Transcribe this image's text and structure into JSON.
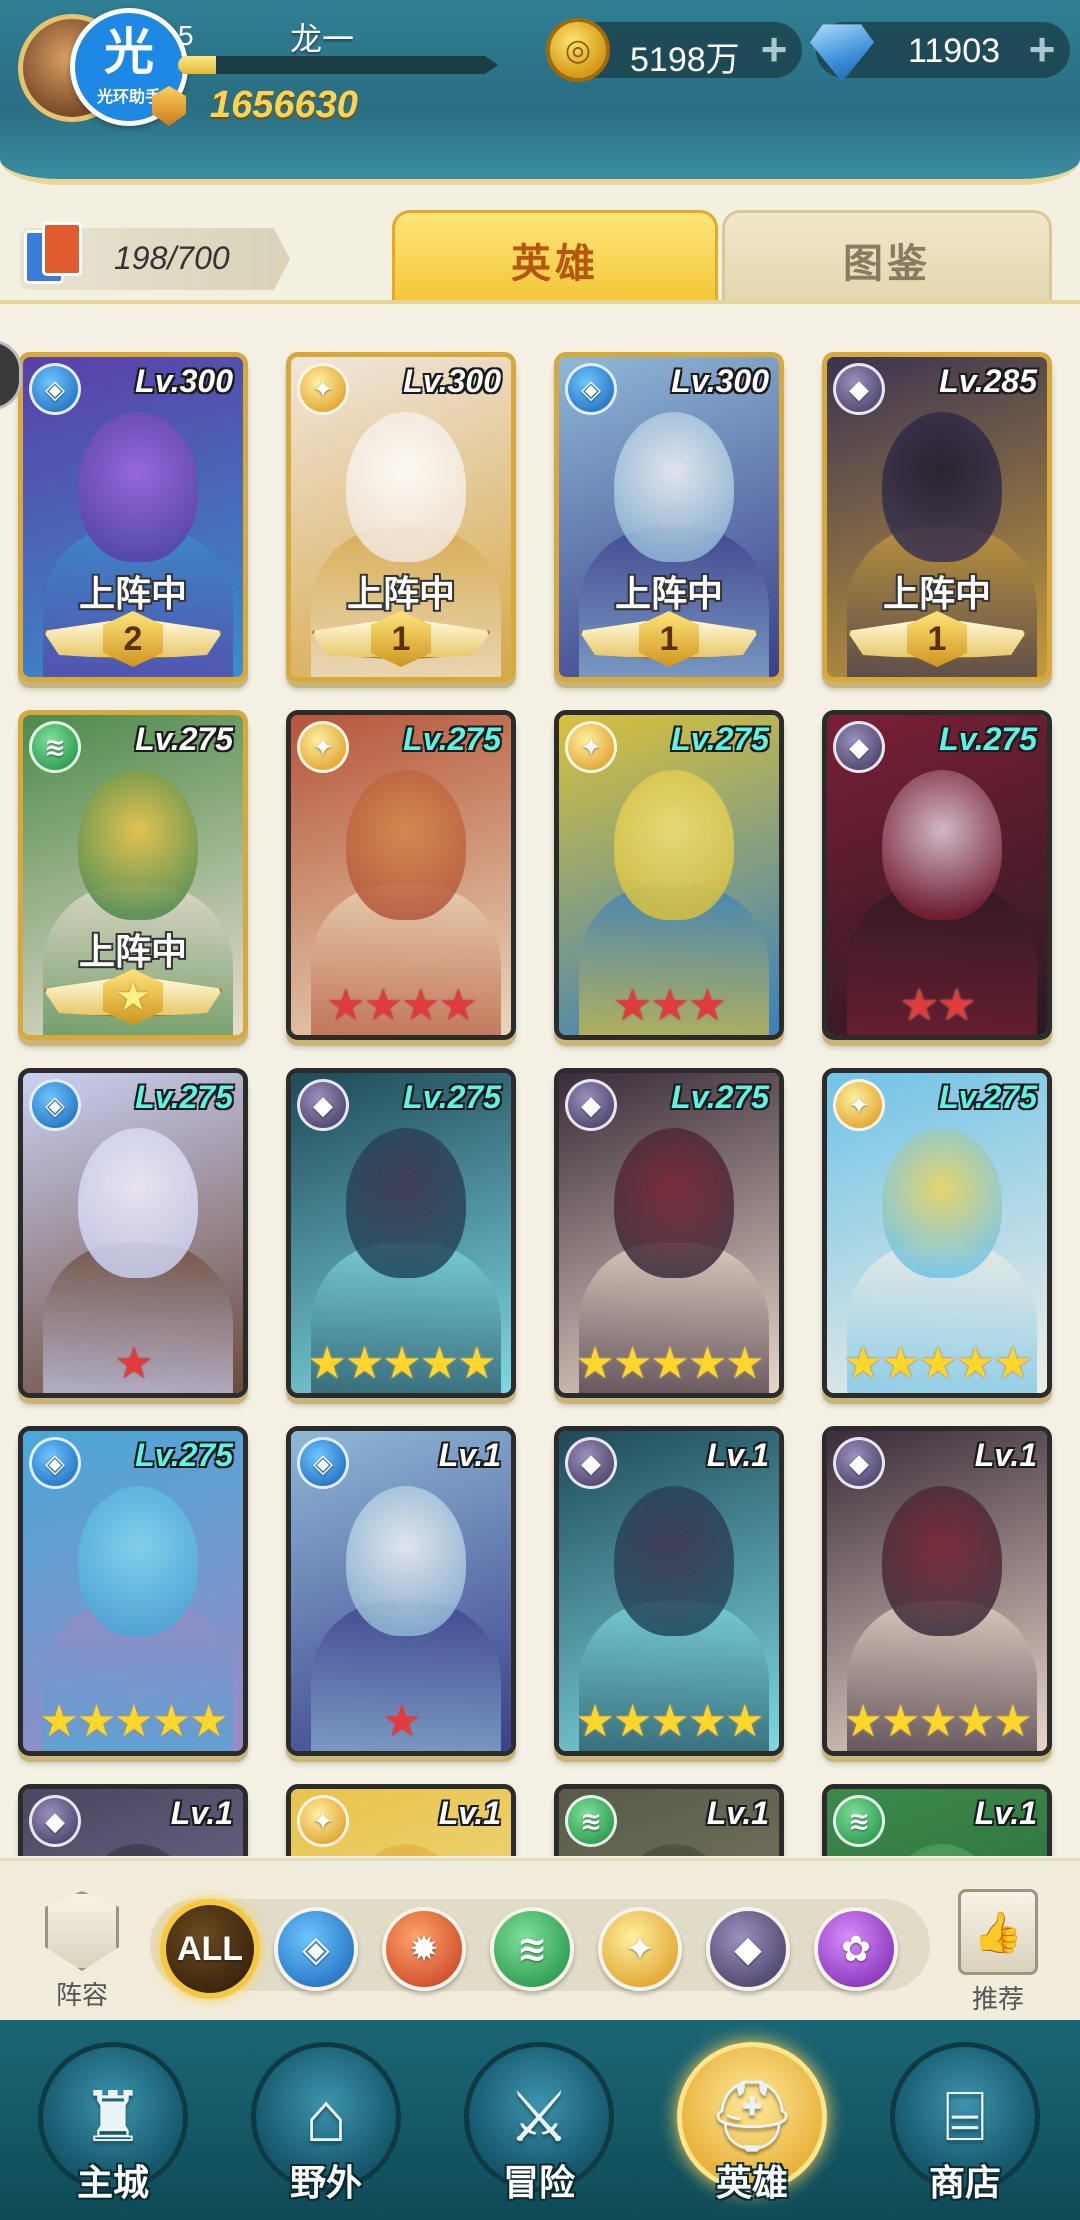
{
  "header": {
    "helper_badge_glyph": "光",
    "helper_badge_text": "光环助手",
    "level": "5",
    "player_name": "龙一",
    "exp_fraction": 0.12,
    "power": "1656630",
    "gold": "5198万",
    "diamonds": "11903",
    "plus": "+"
  },
  "tabs": {
    "hero_count": "198/700",
    "heroes": "英雄",
    "codex": "图鉴"
  },
  "heroes": [
    {
      "level": "Lv.300",
      "faction": "water",
      "deployed": "上阵中",
      "badge": "2",
      "stars": 0,
      "star_color": "",
      "lvl_color": "white",
      "art": [
        "#5a3fa8",
        "#a36ae0",
        "#3a8ec9"
      ]
    },
    {
      "level": "Lv.300",
      "faction": "light",
      "deployed": "上阵中",
      "badge": "1",
      "stars": 0,
      "star_color": "",
      "lvl_color": "white",
      "art": [
        "#f0e6dc",
        "#ffffff",
        "#d6a848"
      ]
    },
    {
      "level": "Lv.300",
      "faction": "water",
      "deployed": "上阵中",
      "badge": "1",
      "stars": 0,
      "star_color": "",
      "lvl_color": "white",
      "art": [
        "#8fb8d6",
        "#f4f4f4",
        "#3b3f8a"
      ]
    },
    {
      "level": "Lv.285",
      "faction": "dark",
      "deployed": "上阵中",
      "badge": "1",
      "stars": 0,
      "star_color": "",
      "lvl_color": "white",
      "art": [
        "#3a3352",
        "#1f1a2b",
        "#c59a3a"
      ]
    },
    {
      "level": "Lv.275",
      "faction": "wind",
      "deployed": "上阵中",
      "badge": "★",
      "stars": 0,
      "star_color": "",
      "lvl_color": "white",
      "art": [
        "#4d8a4a",
        "#f2c64a",
        "#e8ddd0"
      ]
    },
    {
      "level": "Lv.275",
      "faction": "light",
      "deployed": "",
      "badge": "",
      "stars": 4,
      "star_color": "red",
      "lvl_color": "cyan",
      "art": [
        "#b5553a",
        "#d48a4a",
        "#e9d7b8"
      ]
    },
    {
      "level": "Lv.275",
      "faction": "light",
      "deployed": "",
      "badge": "",
      "stars": 3,
      "star_color": "red",
      "lvl_color": "cyan",
      "art": [
        "#d8c13c",
        "#f2e27a",
        "#3a7fbf"
      ]
    },
    {
      "level": "Lv.275",
      "faction": "dark",
      "deployed": "",
      "badge": "",
      "stars": 2,
      "star_color": "red",
      "lvl_color": "cyan",
      "art": [
        "#7a1f35",
        "#e4d3e0",
        "#2b1a22"
      ]
    },
    {
      "level": "Lv.275",
      "faction": "water",
      "deployed": "",
      "badge": "",
      "stars": 1,
      "star_color": "red",
      "lvl_color": "cyan",
      "art": [
        "#c9d0f2",
        "#f4eef8",
        "#6d4a3a"
      ]
    },
    {
      "level": "Lv.275",
      "faction": "dark",
      "deployed": "",
      "badge": "",
      "stars": 5,
      "star_color": "yellow",
      "lvl_color": "cyan",
      "art": [
        "#1f4a5a",
        "#40334f",
        "#7fd8e0"
      ]
    },
    {
      "level": "Lv.275",
      "faction": "dark",
      "deployed": "",
      "badge": "",
      "stars": 5,
      "star_color": "yellow",
      "lvl_color": "cyan",
      "art": [
        "#3a2c3a",
        "#7a2230",
        "#e8d6c8"
      ]
    },
    {
      "level": "Lv.275",
      "faction": "light",
      "deployed": "",
      "badge": "",
      "stars": 5,
      "star_color": "yellow",
      "lvl_color": "cyan",
      "art": [
        "#6fc3e8",
        "#f2d55a",
        "#f0ede4"
      ]
    },
    {
      "level": "Lv.275",
      "faction": "water",
      "deployed": "",
      "badge": "",
      "stars": 5,
      "star_color": "yellow",
      "lvl_color": "cyan",
      "art": [
        "#4aa8d8",
        "#86d8ef",
        "#9a8ac4"
      ]
    },
    {
      "level": "Lv.1",
      "faction": "water",
      "deployed": "",
      "badge": "",
      "stars": 1,
      "star_color": "red",
      "lvl_color": "white",
      "art": [
        "#8fb8d6",
        "#f4f4f4",
        "#3b3f8a"
      ]
    },
    {
      "level": "Lv.1",
      "faction": "dark",
      "deployed": "",
      "badge": "",
      "stars": 5,
      "star_color": "yellow",
      "lvl_color": "white",
      "art": [
        "#1f4a5a",
        "#40334f",
        "#7fd8e0"
      ]
    },
    {
      "level": "Lv.1",
      "faction": "dark",
      "deployed": "",
      "badge": "",
      "stars": 5,
      "star_color": "yellow",
      "lvl_color": "white",
      "art": [
        "#3a2c3a",
        "#7a2230",
        "#e8d6c8"
      ]
    },
    {
      "level": "Lv.1",
      "faction": "dark",
      "deployed": "",
      "badge": "",
      "stars": 0,
      "star_color": "",
      "lvl_color": "white",
      "art": [
        "#4a4760",
        "#2b2838",
        "#8c7fa8"
      ]
    },
    {
      "level": "Lv.1",
      "faction": "light",
      "deployed": "",
      "badge": "",
      "stars": 0,
      "star_color": "",
      "lvl_color": "white",
      "art": [
        "#e8c44a",
        "#d8a030",
        "#f4e4a8"
      ]
    },
    {
      "level": "Lv.1",
      "faction": "wind",
      "deployed": "",
      "badge": "",
      "stars": 0,
      "star_color": "",
      "lvl_color": "white",
      "art": [
        "#5a5a4a",
        "#3a3a30",
        "#8a8a70"
      ]
    },
    {
      "level": "Lv.1",
      "faction": "wind",
      "deployed": "",
      "badge": "",
      "stars": 0,
      "star_color": "",
      "lvl_color": "white",
      "art": [
        "#3a8a4a",
        "#6cc07a",
        "#2a5a3a"
      ]
    }
  ],
  "factions": {
    "water": "water-faction-icon",
    "light": "light-faction-icon",
    "dark": "dark-faction-icon",
    "wind": "wind-faction-icon",
    "fire": "fire-faction-icon",
    "arcane": "arcane-faction-icon"
  },
  "filter": {
    "lineup_label": "阵容",
    "all_label": "ALL",
    "recommend_label": "推荐",
    "buttons": [
      "water",
      "fire",
      "wind",
      "light",
      "dark",
      "arcane"
    ]
  },
  "nav": [
    {
      "label": "主城",
      "icon": "castle-icon",
      "active": false
    },
    {
      "label": "野外",
      "icon": "portal-icon",
      "active": false
    },
    {
      "label": "冒险",
      "icon": "sword-icon",
      "active": false
    },
    {
      "label": "英雄",
      "icon": "helmet-icon",
      "active": true
    },
    {
      "label": "商店",
      "icon": "shop-icon",
      "active": false
    }
  ]
}
